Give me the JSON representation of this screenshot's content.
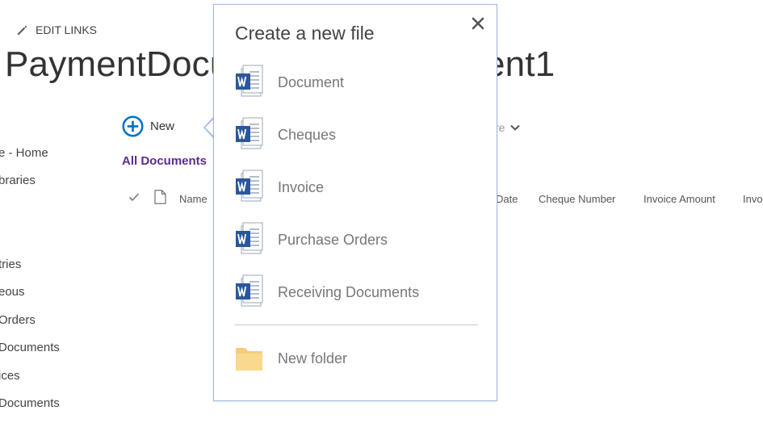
{
  "top": {
    "edit_links": "EDIT LINKS",
    "title_left": "PaymentDocu",
    "title_right": "ent1"
  },
  "nav": {
    "items": [
      "e - Home",
      "braries",
      "tries",
      "eous",
      "Orders",
      "Documents",
      "ices",
      "Documents"
    ]
  },
  "command_bar": {
    "new_label": "New",
    "share_fragment": "re",
    "view_label": "All Documents"
  },
  "columns": {
    "name": "Name",
    "date": "Date",
    "cheque_number": "Cheque Number",
    "invoice_amount": "Invoice Amount",
    "invo": "Invo"
  },
  "panel": {
    "title": "Create a new file",
    "items": [
      {
        "label": "Document",
        "icon": "word-icon"
      },
      {
        "label": "Cheques",
        "icon": "word-icon"
      },
      {
        "label": "Invoice",
        "icon": "word-icon"
      },
      {
        "label": "Purchase Orders",
        "icon": "word-icon"
      },
      {
        "label": "Receiving Documents",
        "icon": "word-icon"
      }
    ],
    "folder_label": "New folder"
  },
  "colors": {
    "accent_blue": "#0072c6",
    "view_purple": "#5c2d91",
    "word_blue": "#2b579a",
    "folder_yellow": "#f5cd7a"
  }
}
